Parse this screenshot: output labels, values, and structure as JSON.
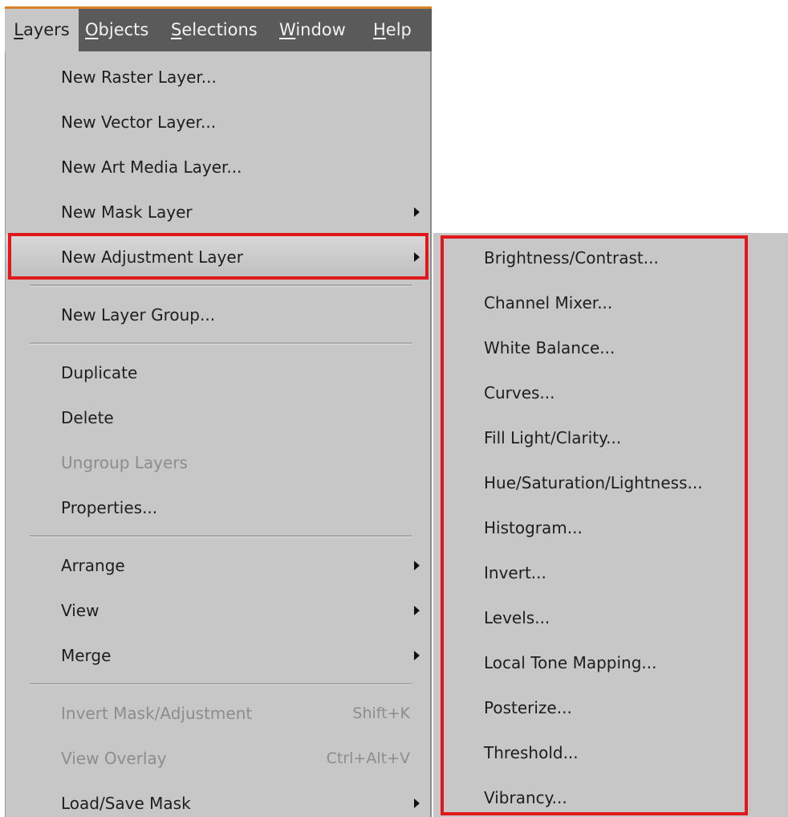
{
  "menubar": {
    "items": [
      {
        "mnemonic": "L",
        "rest": "ayers"
      },
      {
        "mnemonic": "O",
        "rest": "bjects"
      },
      {
        "mnemonic": "S",
        "rest": "elections"
      },
      {
        "mnemonic": "W",
        "rest": "indow"
      },
      {
        "mnemonic": "H",
        "rest": "elp"
      }
    ]
  },
  "layers_menu": {
    "new_raster_layer": "New Raster Layer...",
    "new_vector_layer": "New Vector Layer...",
    "new_art_media_layer": "New Art Media Layer...",
    "new_mask_layer": "New Mask Layer",
    "new_adjustment_layer": "New Adjustment Layer",
    "new_layer_group": "New Layer Group...",
    "duplicate": "Duplicate",
    "delete": "Delete",
    "ungroup_layers": "Ungroup Layers",
    "properties": "Properties...",
    "arrange": "Arrange",
    "view": "View",
    "merge": "Merge",
    "invert_mask_adjustment": "Invert Mask/Adjustment",
    "invert_mask_adjustment_shortcut": "Shift+K",
    "view_overlay": "View Overlay",
    "view_overlay_shortcut": "Ctrl+Alt+V",
    "load_save_mask": "Load/Save Mask"
  },
  "adjustment_submenu": {
    "items": [
      "Brightness/Contrast...",
      "Channel Mixer...",
      "White Balance...",
      "Curves...",
      "Fill Light/Clarity...",
      "Hue/Saturation/Lightness...",
      "Histogram...",
      "Invert...",
      "Levels...",
      "Local Tone Mapping...",
      "Posterize...",
      "Threshold...",
      "Vibrancy..."
    ]
  },
  "colors": {
    "menubar_bg": "#5a5a5a",
    "menubar_accent": "#d9822b",
    "menu_bg": "#c7c7c7",
    "highlight_box": "#e0181b",
    "disabled_text": "#8d8d8d"
  }
}
